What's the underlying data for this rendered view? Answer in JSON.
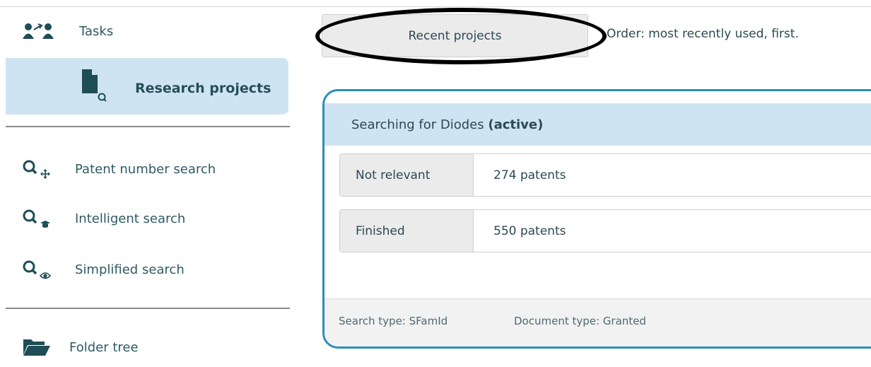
{
  "sidebar": {
    "tasks": {
      "label": "Tasks",
      "icon": "users-transfer-icon"
    },
    "research_projects": {
      "label": "Research projects",
      "icon": "document-search-icon",
      "active": true
    },
    "searches": [
      {
        "label": "Patent number search",
        "icon": "search-move-icon"
      },
      {
        "label": "Intelligent search",
        "icon": "search-graduate-icon"
      },
      {
        "label": "Simplified search",
        "icon": "search-eye-icon"
      }
    ],
    "folder_tree": {
      "label": "Folder tree",
      "icon": "folder-open-icon"
    }
  },
  "main": {
    "recent_button": "Recent projects",
    "order_text": "Order: most recently used, first.",
    "project": {
      "title": "Searching for Diodes",
      "status": "(active)",
      "rows": [
        {
          "key": "Not relevant",
          "value": "274 patents"
        },
        {
          "key": "Finished",
          "value": "550 patents"
        }
      ],
      "search_type": "Search type: SFamId",
      "document_type": "Document type: Granted"
    }
  },
  "colors": {
    "accent_blue": "#2a8fb8",
    "highlight_bg": "#cfe4f3",
    "text": "#2b4a52",
    "annotation": "#000000"
  }
}
